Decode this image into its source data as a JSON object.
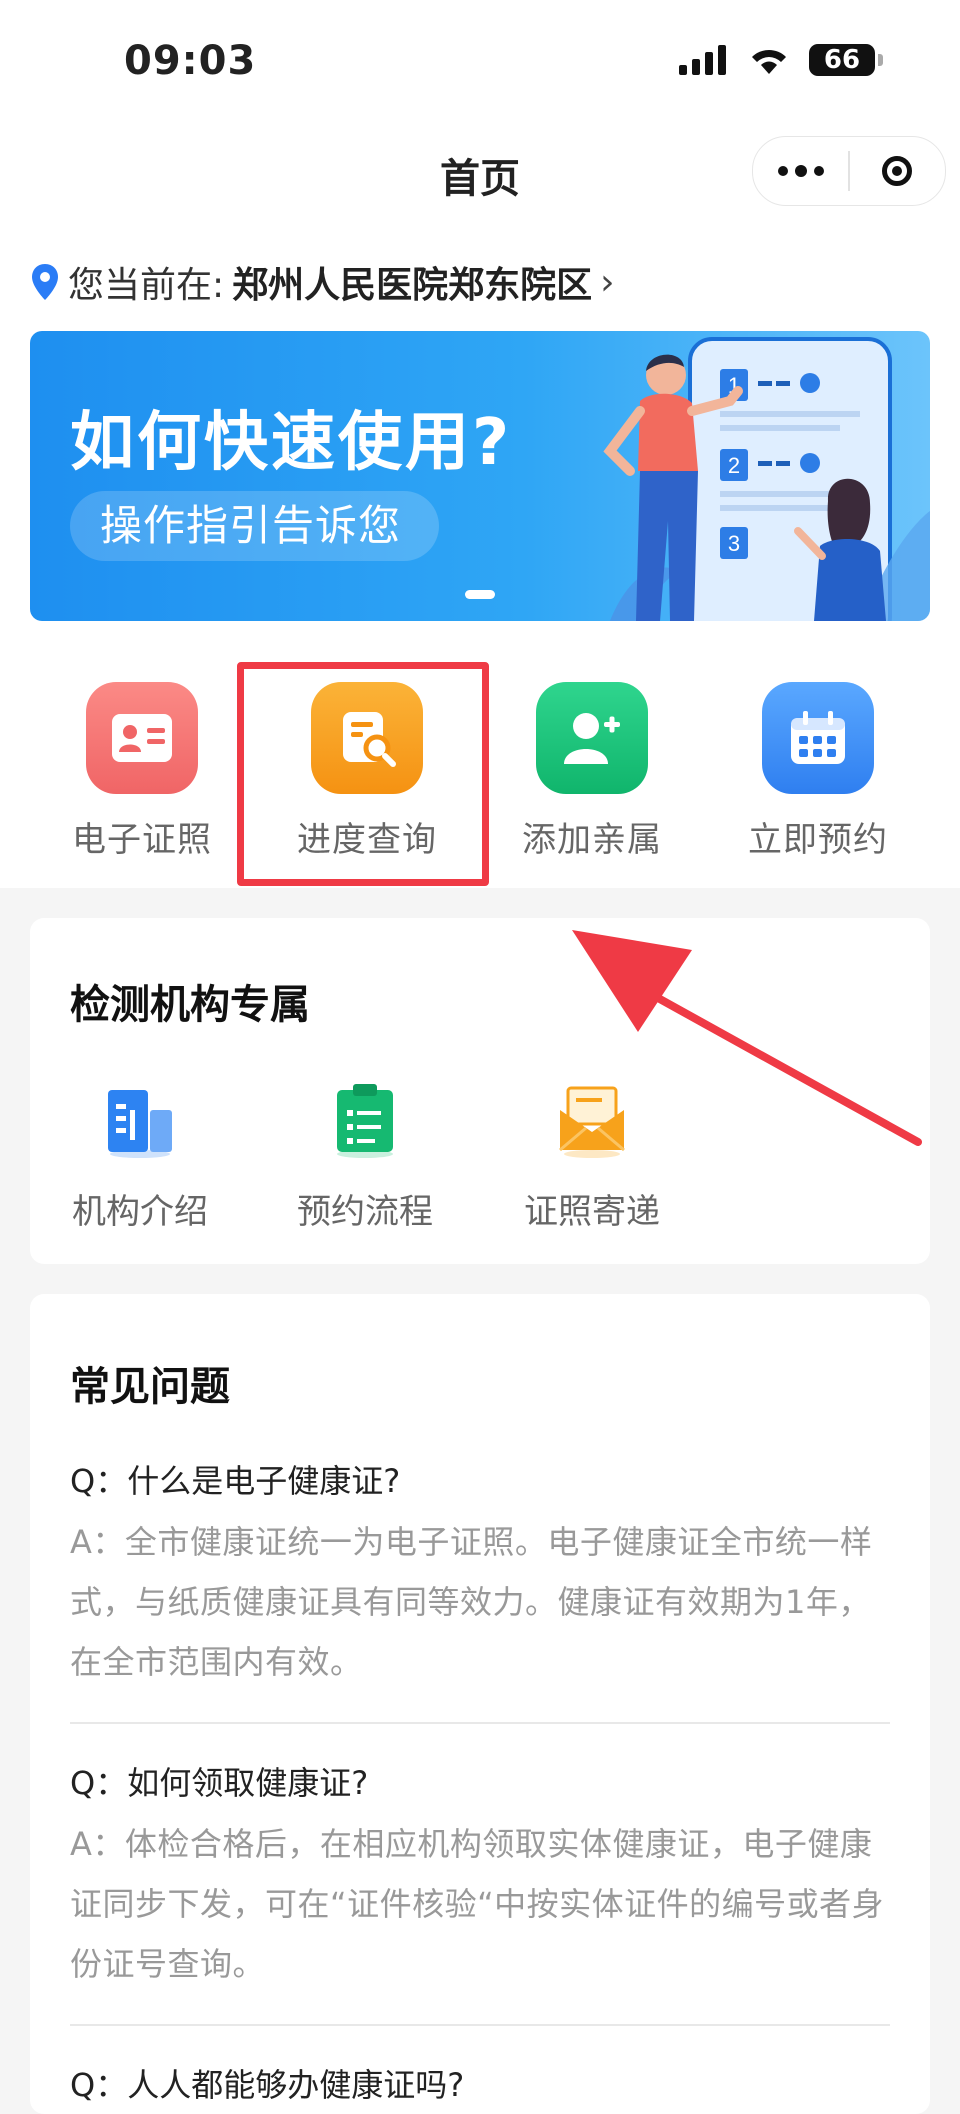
{
  "status_bar": {
    "time": "09:03",
    "battery": "66"
  },
  "nav": {
    "title": "首页"
  },
  "location": {
    "label": "您当前在:",
    "hospital": "郑州人民医院郑东院区",
    "chevron": "›"
  },
  "banner": {
    "title": "如何快速使用?",
    "subtitle": "操作指引告诉您"
  },
  "quick_menu": [
    {
      "label": "电子证照",
      "color": "#f26e6e"
    },
    {
      "label": "进度查询",
      "color": "#f7a21b"
    },
    {
      "label": "添加亲属",
      "color": "#19c37d"
    },
    {
      "label": "立即预约",
      "color": "#3b8cf2"
    }
  ],
  "institution": {
    "title": "检测机构专属",
    "items": [
      {
        "label": "机构介绍"
      },
      {
        "label": "预约流程"
      },
      {
        "label": "证照寄递"
      }
    ]
  },
  "faq": {
    "title": "常见问题",
    "items": [
      {
        "q": "Q：什么是电子健康证?",
        "a": "A：全市健康证统一为电子证照。电子健康证全市统一样式，与纸质健康证具有同等效力。健康证有效期为1年，在全市范围内有效。"
      },
      {
        "q": "Q：如何领取健康证?",
        "a": "A：体检合格后，在相应机构领取实体健康证，电子健康证同步下发，可在“证件核验“中按实体证件的编号或者身份证号查询。"
      },
      {
        "q": "Q：人人都能够办健康证吗?",
        "a": ""
      }
    ]
  },
  "annotation_colors": {
    "highlight_box": "#ef3a45",
    "arrow": "#ef3a45"
  }
}
